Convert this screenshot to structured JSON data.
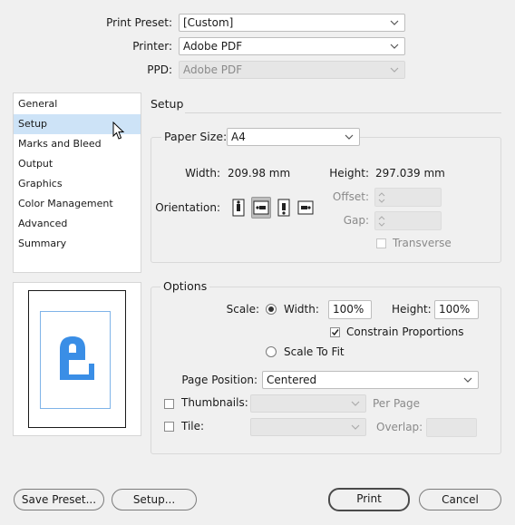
{
  "header": {
    "print_preset_label": "Print Preset:",
    "print_preset_value": "[Custom]",
    "printer_label": "Printer:",
    "printer_value": "Adobe PDF",
    "ppd_label": "PPD:",
    "ppd_value": "Adobe PDF"
  },
  "sidebar": {
    "items": [
      {
        "label": "General",
        "selected": false
      },
      {
        "label": "Setup",
        "selected": true
      },
      {
        "label": "Marks and Bleed",
        "selected": false
      },
      {
        "label": "Output",
        "selected": false
      },
      {
        "label": "Graphics",
        "selected": false
      },
      {
        "label": "Color Management",
        "selected": false
      },
      {
        "label": "Advanced",
        "selected": false
      },
      {
        "label": "Summary",
        "selected": false
      }
    ]
  },
  "section_title": "Setup",
  "paper": {
    "paper_size_label": "Paper Size:",
    "paper_size_value": "A4",
    "width_label": "Width:",
    "width_value": "209.98 mm",
    "height_label": "Height:",
    "height_value": "297.039 mm",
    "orientation_label": "Orientation:",
    "offset_label": "Offset:",
    "gap_label": "Gap:",
    "transverse_label": "Transverse"
  },
  "options": {
    "legend": "Options",
    "scale_label": "Scale:",
    "width_label": "Width:",
    "width_value": "100%",
    "height_label": "Height:",
    "height_value": "100%",
    "constrain_label": "Constrain Proportions",
    "scale_to_fit_label": "Scale To Fit",
    "page_position_label": "Page Position:",
    "page_position_value": "Centered",
    "thumbnails_label": "Thumbnails:",
    "per_page_label": "Per Page",
    "tile_label": "Tile:",
    "overlap_label": "Overlap:"
  },
  "buttons": {
    "save_preset": "Save Preset...",
    "setup": "Setup...",
    "print": "Print",
    "cancel": "Cancel"
  },
  "colors": {
    "selection": "#cde3f7",
    "preview_accent": "#3a8ee6"
  }
}
